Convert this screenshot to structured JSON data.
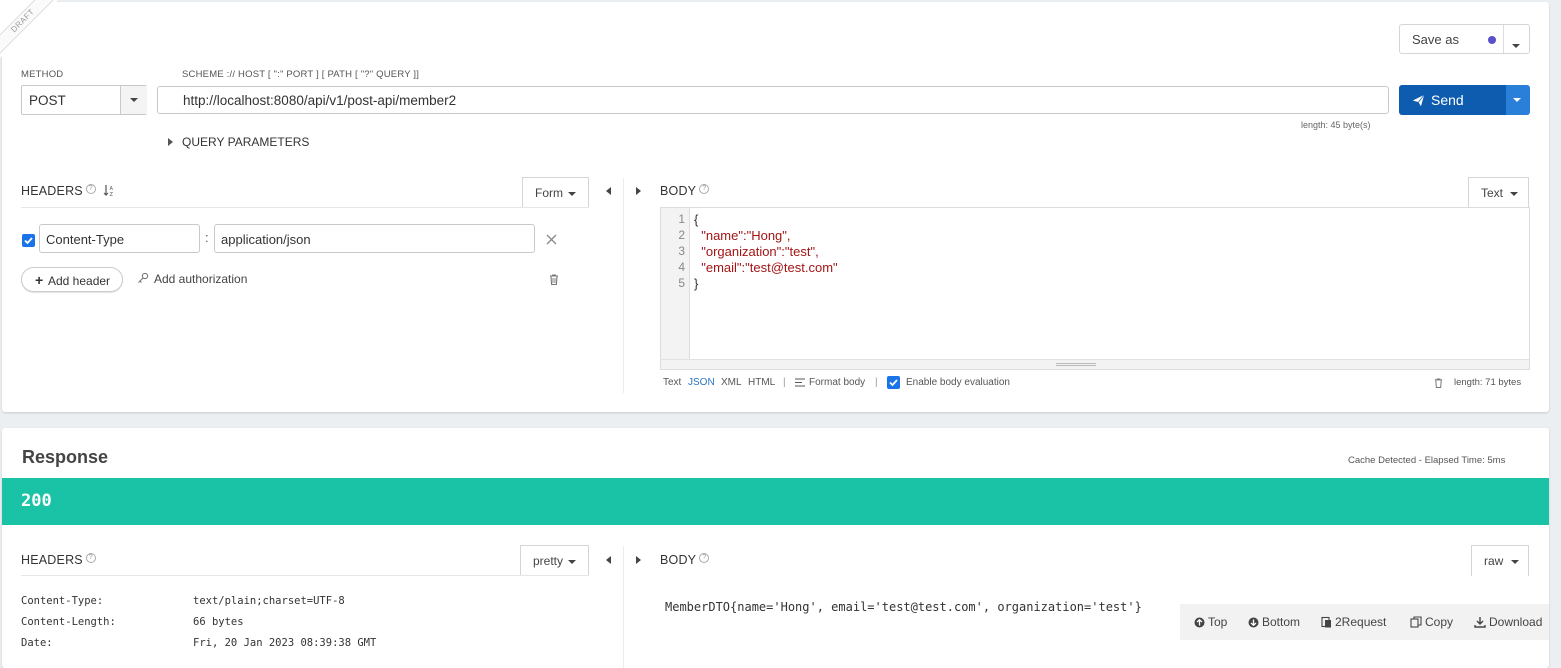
{
  "draft_label": "DRAFT",
  "save_as": {
    "label": "Save as"
  },
  "method": {
    "label": "METHOD",
    "value": "POST"
  },
  "url": {
    "label": "SCHEME :// HOST [ \":\" PORT ] [ PATH [ \"?\" QUERY ]]",
    "value": "http://localhost:8080/api/v1/post-api/member2",
    "length": "length: 45 byte(s)"
  },
  "send": {
    "label": "Send"
  },
  "query_params": {
    "label": "QUERY PARAMETERS"
  },
  "request_headers": {
    "title": "HEADERS",
    "mode": "Form",
    "rows": [
      {
        "name": "Content-Type",
        "value": "application/json",
        "enabled": true
      }
    ],
    "add_header": "Add header",
    "add_authorization": "Add authorization"
  },
  "request_body": {
    "title": "BODY",
    "mode": "Text",
    "lines": [
      {
        "num": "1",
        "text": "{"
      },
      {
        "num": "2",
        "text": "  \"name\":\"Hong\","
      },
      {
        "num": "3",
        "text": "  \"organization\":\"test\","
      },
      {
        "num": "4",
        "text": "  \"email\":\"test@test.com\""
      },
      {
        "num": "5",
        "text": "}"
      }
    ],
    "formats": [
      "Text",
      "JSON",
      "XML",
      "HTML"
    ],
    "active_format": "JSON",
    "format_body": "Format body",
    "enable_eval": "Enable body evaluation",
    "length": "length: 71 bytes"
  },
  "response": {
    "title": "Response",
    "cache_info": "Cache Detected - Elapsed Time: 5ms",
    "status_code": "200",
    "headers": {
      "title": "HEADERS",
      "mode": "pretty",
      "rows": [
        {
          "name": "Content-Type:",
          "value": "text/plain;charset=UTF-8"
        },
        {
          "name": "Content-Length:",
          "value": "66 bytes"
        },
        {
          "name": "Date:",
          "value": "Fri, 20 Jan 2023 08:39:38 GMT"
        }
      ]
    },
    "body": {
      "title": "BODY",
      "mode": "raw",
      "content": "MemberDTO{name='Hong', email='test@test.com', organization='test'}"
    },
    "tools": {
      "top": "Top",
      "bottom": "Bottom",
      "to_request": "2Request",
      "copy": "Copy",
      "download": "Download"
    }
  },
  "colors": {
    "accent": "#0d5cb0",
    "status_ok": "#1bc3a6",
    "save_dot": "#5a4fcf"
  }
}
